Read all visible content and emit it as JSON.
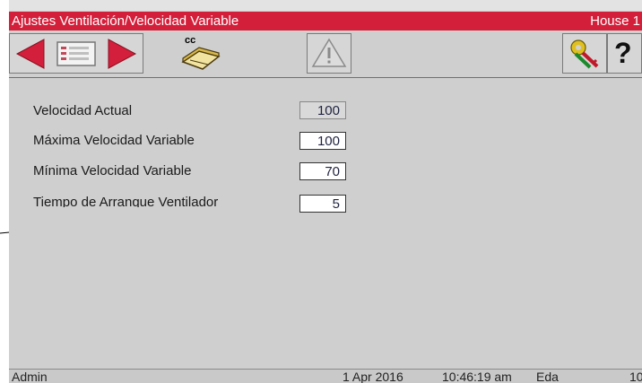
{
  "header": {
    "title": "Ajustes Ventilación/Velocidad Variable",
    "house": "House 1"
  },
  "toolbar": {
    "back_icon": "arrow-left-icon",
    "list_icon": "list-icon",
    "forward_icon": "arrow-right-icon",
    "cc_label": "cc",
    "cc_icon": "house-icon",
    "warning_icon": "warning-icon",
    "keys_icon": "keys-icon",
    "help_label": "?"
  },
  "settings": {
    "current_speed": {
      "label": "Velocidad Actual",
      "value": "100"
    },
    "max_speed": {
      "label": "Máxima Velocidad Variable",
      "value": "100"
    },
    "min_speed": {
      "label": "Mínima Velocidad Variable",
      "value": "70"
    },
    "fan_start_time": {
      "label": "Tiempo de Arranque Ventilador",
      "value": "5"
    }
  },
  "status": {
    "user": "Admin",
    "date": "1 Apr 2016",
    "time": "10:46:19 am",
    "mode": "Eda",
    "extra": "10"
  },
  "colors": {
    "titlebar": "#d41f3a",
    "arrow": "#d31f3b",
    "background": "#cfcfcf"
  }
}
